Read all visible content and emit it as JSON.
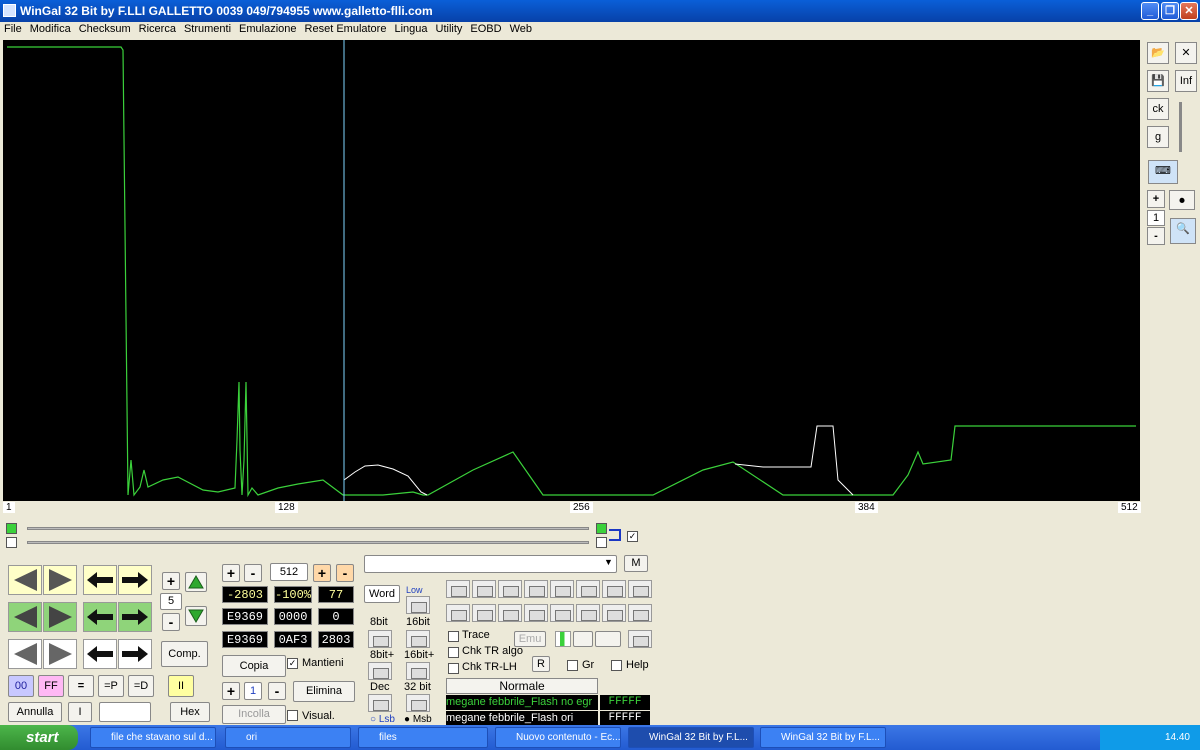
{
  "window": {
    "title": "WinGal 32 Bit  by  F.LLI GALLETTO     0039  049/794955  www.galletto-flli.com",
    "min": "_",
    "max": "❐",
    "close": "✕"
  },
  "menu": [
    "File",
    "Modifica",
    "Checksum",
    "Ricerca",
    "Strumenti",
    "Emulazione",
    "Reset Emulatore",
    "Lingua",
    "Utility",
    "EOBD",
    "Web"
  ],
  "axis": {
    "labels": [
      "1",
      "128",
      "256",
      "384",
      "512"
    ]
  },
  "right_panel": {
    "inf": "Inf",
    "ck": "ck",
    "g": "g",
    "plus": "+",
    "minus": "-",
    "zoom_value": "1"
  },
  "colors": {
    "graph_bg": "#000000",
    "series1": "#3bd13b",
    "series2": "#ffffff",
    "cursor": "#7fd6ff"
  },
  "nav": {
    "step_plus": "+",
    "step_minus": "-",
    "step_value": "5",
    "comp": "Comp.",
    "btn_00": "00",
    "btn_ff": "FF",
    "btn_eq": "=",
    "btn_eqp": "=P",
    "btn_eqd": "=D",
    "btn_ii": "II",
    "annulla": "Annulla",
    "btn_i": "I",
    "hex": "Hex",
    "input": ""
  },
  "values": {
    "plus": "+",
    "minus": "-",
    "count": "512",
    "r1": [
      "-2803",
      "-100%",
      "77"
    ],
    "r2": [
      "E9369",
      "0000",
      "0"
    ],
    "r3": [
      "E9369",
      "0AF3",
      "2803"
    ],
    "copia": "Copia",
    "mantieni": "Mantieni",
    "small_value": "1",
    "elimina": "Elimina",
    "incolla": "Incolla",
    "visual": "Visual."
  },
  "mode": {
    "word": "Word",
    "low": "Low",
    "b8": "8bit",
    "b16": "16bit",
    "b8p": "8bit+",
    "b16p": "16bit+",
    "dec": "Dec",
    "b32": "32 bit",
    "lsb": "Lsb",
    "msb": "Msb",
    "dropdown": "",
    "m": "M"
  },
  "checks": {
    "trace": "Trace",
    "chk_tr_algo": "Chk TR algo",
    "chk_tr_lh": "Chk TR-LH",
    "emu": "Emu",
    "r": "R",
    "gr": "Gr",
    "help": "Help"
  },
  "files": {
    "header": "Normale",
    "f1": "megane febbrile_Flash no egr",
    "f1v": "FFFFF",
    "f2": "megane febbrile_Flash ori",
    "f2v": "FFFFF"
  },
  "taskbar": {
    "start": "start",
    "tasks": [
      "file che stavano sul d...",
      "ori",
      "files",
      "Nuovo contenuto - Ec...",
      "WinGal 32 Bit  by  F.L...",
      "WinGal 32 Bit  by  F.L..."
    ],
    "clock": "14.40"
  }
}
